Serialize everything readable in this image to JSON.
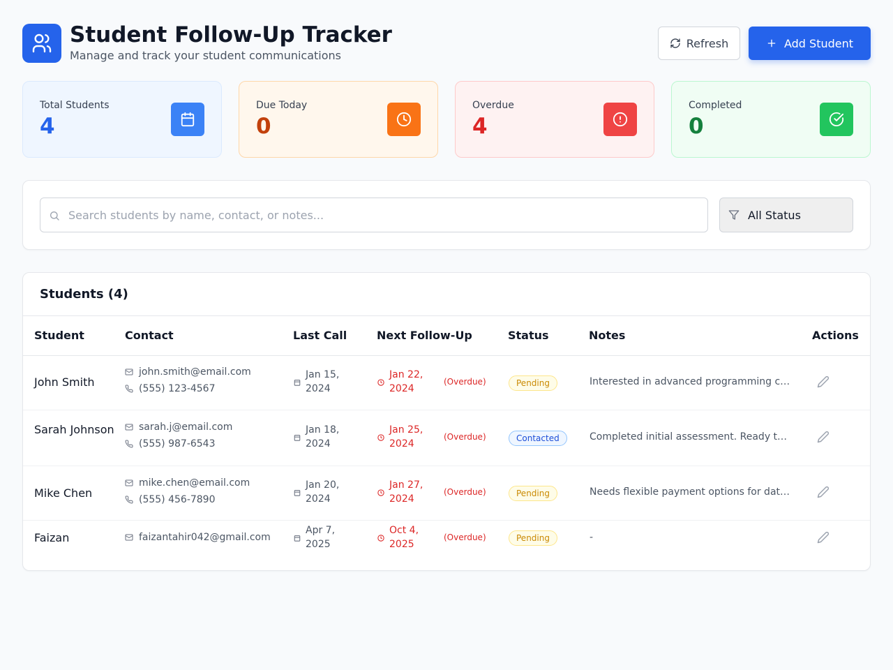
{
  "header": {
    "title": "Student Follow-Up Tracker",
    "subtitle": "Manage and track your student communications",
    "refresh_label": "Refresh",
    "add_label": "Add Student"
  },
  "stats": [
    {
      "label": "Total Students",
      "value": "4",
      "icon": "calendar-icon",
      "color": "#2563eb",
      "bg": "#eff6ff",
      "border": "#dbeafe",
      "icon_bg": "#3b82f6"
    },
    {
      "label": "Due Today",
      "value": "0",
      "icon": "clock-icon",
      "color": "#c2410c",
      "bg": "#fff7ed",
      "border": "#fed7aa",
      "icon_bg": "#f97316"
    },
    {
      "label": "Overdue",
      "value": "4",
      "icon": "alert-circle-icon",
      "color": "#dc2626",
      "bg": "#fef2f2",
      "border": "#fecaca",
      "icon_bg": "#ef4444"
    },
    {
      "label": "Completed",
      "value": "0",
      "icon": "check-circle-icon",
      "color": "#15803d",
      "bg": "#f0fdf4",
      "border": "#bbf7d0",
      "icon_bg": "#22c55e"
    }
  ],
  "search": {
    "placeholder": "Search students by name, contact, or notes...",
    "value": "",
    "status_filter": "All Status"
  },
  "table": {
    "title": "Students (4)",
    "columns": [
      "Student",
      "Contact",
      "Last Call",
      "Next Follow-Up",
      "Status",
      "Notes",
      "Actions"
    ],
    "rows": [
      {
        "name": "John Smith",
        "email": "john.smith@email.com",
        "phone": "(555) 123-4567",
        "last_call": "Jan 15, 2024",
        "next": "Jan 22, 2024",
        "overdue": "(Overdue)",
        "status": "Pending",
        "notes": "Interested in advanced programming courses"
      },
      {
        "name": "Sarah Johnson",
        "email": "sarah.j@email.com",
        "phone": "(555) 987-6543",
        "last_call": "Jan 18, 2024",
        "next": "Jan 25, 2024",
        "overdue": "(Overdue)",
        "status": "Contacted",
        "notes": "Completed initial assessment. Ready to enroll"
      },
      {
        "name": "Mike Chen",
        "email": "mike.chen@email.com",
        "phone": "(555) 456-7890",
        "last_call": "Jan 20, 2024",
        "next": "Jan 27, 2024",
        "overdue": "(Overdue)",
        "status": "Pending",
        "notes": "Needs flexible payment options for data science"
      },
      {
        "name": "Faizan",
        "email": "faizantahir042@gmail.com",
        "phone": "",
        "last_call": "Apr 7, 2025",
        "next": "Oct 4, 2025",
        "overdue": "(Overdue)",
        "status": "Pending",
        "notes": "-"
      }
    ]
  }
}
